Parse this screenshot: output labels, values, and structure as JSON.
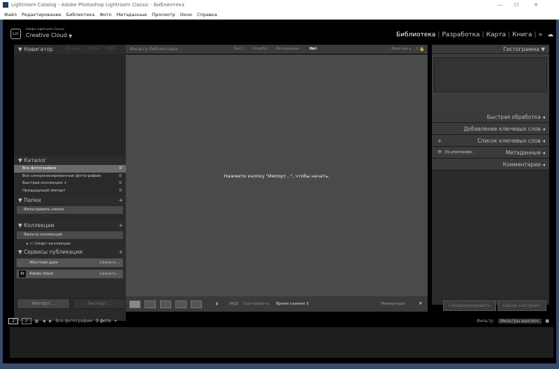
{
  "window": {
    "title": "Lightroom Catalog - Adobe Photoshop Lightroom Classic - Библиотека",
    "min": "—",
    "max": "☐",
    "close": "✕"
  },
  "menu": [
    "Файл",
    "Редактирование",
    "Библиотека",
    "Фото",
    "Метаданные",
    "Просмотр",
    "Окно",
    "Справка"
  ],
  "brand": {
    "logo": "Lrc",
    "small": "Adobe Lightroom Classic",
    "name": "Creative Cloud"
  },
  "modules": [
    "Библиотека",
    "Разработка",
    "Карта",
    "Книга",
    "»"
  ],
  "navigator": {
    "title": "Навигатор",
    "opts": [
      "По разм.",
      "100%",
      "200%"
    ]
  },
  "catalog": {
    "title": "Каталог",
    "rows": [
      {
        "label": "Все фотографии",
        "count": "0"
      },
      {
        "label": "Все синхронизированные фотографии",
        "count": "0"
      },
      {
        "label": "Быстрая коллекция  +",
        "count": "0"
      },
      {
        "label": "Предыдущий импорт",
        "count": "0"
      }
    ]
  },
  "folders": {
    "title": "Папки",
    "filter": "Фильтровать папки"
  },
  "collections": {
    "title": "Коллекции",
    "filter": "Фильтр коллекций",
    "smart": "Смарт-коллекции"
  },
  "publish": {
    "title": "Сервисы публикации",
    "rows": [
      {
        "label": "Жесткий диск",
        "action": "Связать..."
      },
      {
        "label": "Adobe Stock",
        "action": "Связать..."
      }
    ]
  },
  "left_buttons": {
    "import": "Импорт...",
    "export": "Экспорт..."
  },
  "filterbar": {
    "title": "Фильтр библиотеки :",
    "tabs": [
      "Текст",
      "Атрибут",
      "Метаданные",
      "Нет"
    ],
    "preset": "Фильтры в... ⇕"
  },
  "center": {
    "message": "Нажмите кнопку \"Импорт...\", чтобы начать."
  },
  "toolbar": {
    "sort_label": "Сортировать",
    "sort_value": "Время съемки ⇕",
    "thumbs": "Миниатюры"
  },
  "right": {
    "panels": [
      "Гистограмма",
      "Быстрая обработка",
      "Добавление ключевых слов",
      "Список ключевых слов",
      "Метаданные",
      "Комментарии"
    ],
    "meta_preset": "По умолчанию",
    "sync": "Синхронизировать",
    "sync_settings": "Синхр. настройк."
  },
  "filmstrip": {
    "screen1": "1",
    "screen2": "2",
    "source": "Все фотографии",
    "count": "0 фото",
    "filter_label": "Фильтр:",
    "filter_value": "Фильтры выключ."
  }
}
